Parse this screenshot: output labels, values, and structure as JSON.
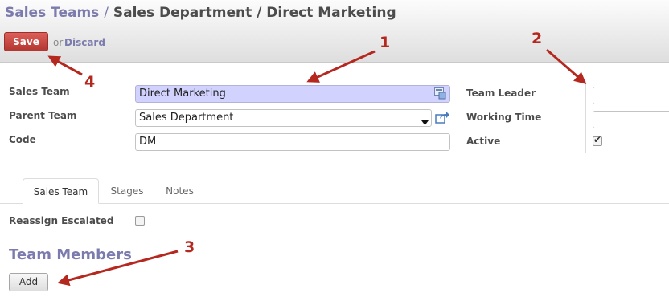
{
  "header": {
    "breadcrumb": {
      "root": "Sales Teams",
      "separator": "/",
      "current": "Sales Department / Direct Marketing"
    },
    "save_label": "Save",
    "or_label": "or",
    "discard_label": "Discard"
  },
  "form": {
    "sales_team_label": "Sales Team",
    "sales_team_value": "Direct Marketing",
    "parent_team_label": "Parent Team",
    "parent_team_value": "Sales Department",
    "code_label": "Code",
    "code_value": "DM",
    "team_leader_label": "Team Leader",
    "team_leader_value": "",
    "working_time_label": "Working Time",
    "working_time_value": "",
    "active_label": "Active",
    "active_checked": true
  },
  "tabs": [
    {
      "label": "Sales Team",
      "active": true
    },
    {
      "label": "Stages",
      "active": false
    },
    {
      "label": "Notes",
      "active": false
    }
  ],
  "tab_content": {
    "reassign_label": "Reassign Escalated",
    "reassign_checked": false,
    "section_title": "Team Members",
    "add_label": "Add"
  },
  "annotations": [
    "1",
    "2",
    "3",
    "4"
  ],
  "colors": {
    "brand": "#7c7bad",
    "save": "#c9403a",
    "required_field": "#d2d2ff",
    "annotation": "#b5281f"
  }
}
